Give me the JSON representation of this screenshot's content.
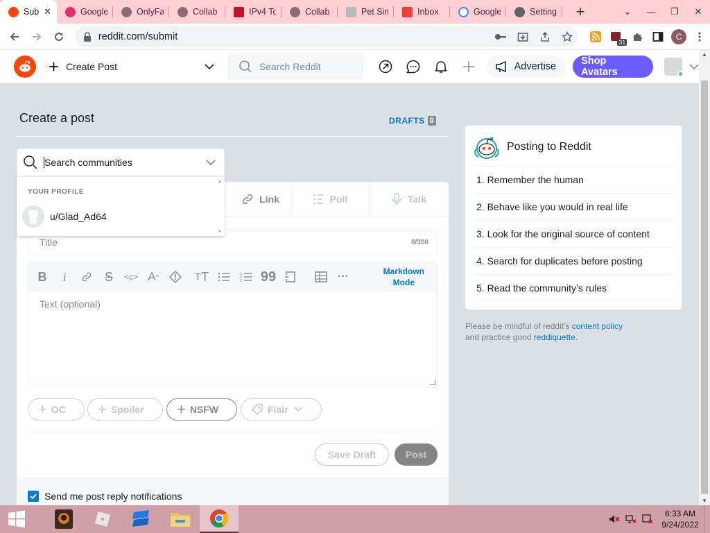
{
  "browser": {
    "tabs": [
      {
        "title": "Sub",
        "active": true,
        "favicon_color": "#ff4500"
      },
      {
        "title": "Google",
        "favicon_color": "#e1306c"
      },
      {
        "title": "OnlyFa",
        "favicon_color": "#8a6d73"
      },
      {
        "title": "Collab",
        "favicon_color": "#8a6d73"
      },
      {
        "title": "IPv4 To",
        "favicon_color": "#c4142a"
      },
      {
        "title": "Collab",
        "favicon_color": "#8a6d73"
      },
      {
        "title": "Pet Sim",
        "favicon_color": "#b9b9b9"
      },
      {
        "title": "Inbox",
        "favicon_color": "#ea4335"
      },
      {
        "title": "Google",
        "favicon_color": "#4285f4"
      },
      {
        "title": "Setting",
        "favicon_color": "#5f6368"
      }
    ],
    "new_tab": "+",
    "url": "reddit.com/submit",
    "extension_badge": "31",
    "profile_initial": "C"
  },
  "reddit_header": {
    "create_post_label": "Create Post",
    "search_placeholder": "Search Reddit",
    "advertise_label": "Advertise",
    "shop_avatars_label": "Shop Avatars"
  },
  "main": {
    "page_title": "Create a post",
    "drafts_label": "DRAFTS",
    "drafts_count": "0",
    "community_search": {
      "value": "Search communities"
    },
    "community_menu": {
      "section_label": "YOUR PROFILE",
      "profile_name": "u/Glad_Ad64"
    },
    "post_tabs": [
      {
        "label": "Link"
      },
      {
        "label": "Poll"
      },
      {
        "label": "Talk"
      }
    ],
    "title_placeholder": "Title",
    "title_counter": "0/300",
    "markdown_mode_line1": "Markdown",
    "markdown_mode_line2": "Mode",
    "text_placeholder": "Text (optional)",
    "flag_buttons": {
      "oc": "OC",
      "spoiler": "Spoiler",
      "nsfw": "NSFW",
      "flair": "Flair"
    },
    "save_draft_label": "Save Draft",
    "post_label": "Post",
    "notify_label": "Send me post reply notifications",
    "notify_checked": true
  },
  "sidebar": {
    "title": "Posting to Reddit",
    "rules": [
      "1. Remember the human",
      "2. Behave like you would in real life",
      "3. Look for the original source of content",
      "4. Search for duplicates before posting",
      "5. Read the community’s rules"
    ],
    "mindful_prefix": "Please be mindful of reddit's ",
    "content_policy_link": "content policy",
    "mindful_middle": "and practice good ",
    "reddiquette_link": "reddiquette",
    "mindful_suffix": "."
  },
  "taskbar": {
    "time": "6:33 AM",
    "date": "9/24/2022"
  },
  "colors": {
    "reddit_orange": "#ff4500",
    "reddit_blue": "#0079d3",
    "shop_purple": "#6a5cff",
    "tabstrip": "#ffd0d5",
    "taskbar": "#cfa0a8"
  }
}
